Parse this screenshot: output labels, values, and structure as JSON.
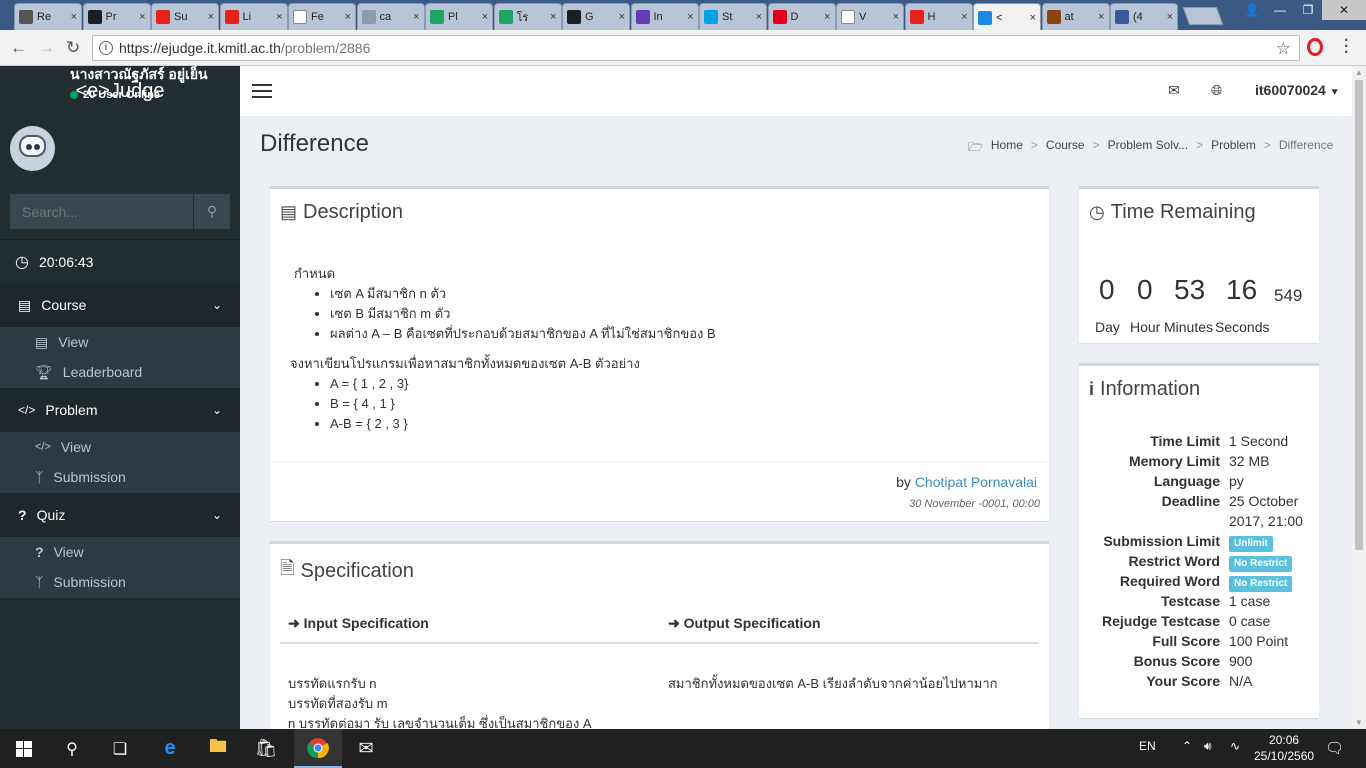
{
  "browser": {
    "tabs": [
      {
        "label": "Re",
        "icon": "app-icon",
        "color": "#555555"
      },
      {
        "label": "Pr",
        "icon": "github-icon",
        "color": "#1b1f23"
      },
      {
        "label": "Su",
        "icon": "youtube-icon",
        "color": "#e62117"
      },
      {
        "label": "Li",
        "icon": "youtube-icon",
        "color": "#e62117"
      },
      {
        "label": "Fe",
        "icon": "page-icon",
        "color": "#ffffff"
      },
      {
        "label": "ca",
        "icon": "code-icon",
        "color": "#8a9bb0"
      },
      {
        "label": "Pl",
        "icon": "drive-icon",
        "color": "#1fa463"
      },
      {
        "label": "โร",
        "icon": "drive-icon",
        "color": "#1fa463"
      },
      {
        "label": "G",
        "icon": "github-icon",
        "color": "#1b1f23"
      },
      {
        "label": "In",
        "icon": "forms-icon",
        "color": "#673ab7"
      },
      {
        "label": "St",
        "icon": "u-icon",
        "color": "#00a4e4"
      },
      {
        "label": "D",
        "icon": "music-icon",
        "color": "#e2001a"
      },
      {
        "label": "V",
        "icon": "page-icon",
        "color": "#ffffff"
      },
      {
        "label": "H",
        "icon": "youtube-icon",
        "color": "#e62117"
      },
      {
        "label": "<",
        "icon": "it-icon",
        "color": "#1e88e5",
        "active": true
      },
      {
        "label": "at",
        "icon": "paw-icon",
        "color": "#8b4513"
      },
      {
        "label": "(4",
        "icon": "facebook-icon",
        "color": "#3b5998"
      }
    ],
    "url_main": "https://ejudge.it.kmitl.ac.th",
    "url_path": "/problem/2886"
  },
  "app": {
    "brand": "<e>Judge",
    "user_fullname": "นางสาวณัฐภัสร์ อยู่เย็น",
    "online": "20 User Online",
    "search_placeholder": "Search...",
    "clock": "20:06:43",
    "menu": {
      "course": "Course",
      "course_view": "View",
      "course_leaderboard": "Leaderboard",
      "problem": "Problem",
      "problem_view": "View",
      "problem_submission": "Submission",
      "quiz": "Quiz",
      "quiz_view": "View",
      "quiz_submission": "Submission"
    },
    "topbar_user": "it60070024"
  },
  "page": {
    "title": "Difference",
    "breadcrumb": [
      "Home",
      "Course",
      "Problem Solv...",
      "Problem",
      "Difference"
    ]
  },
  "description": {
    "heading": "Description",
    "intro": "กำหนด",
    "bullets1": [
      "เซต A มีสมาชิก n ตัว",
      "เซต B มีสมาชิก m ตัว",
      "ผลต่าง A – B คือเซตที่ประกอบด้วยสมาชิกของ A ที่ไม่ใช่สมาชิกของ B"
    ],
    "task": "จงหาเขียนโปรแกรมเพื่อหาสมาชิกทั้งหมดของเซต A-B ตัวอย่าง",
    "bullets2": [
      "A = { 1 , 2 , 3}",
      "B = { 4 , 1 }",
      "A-B = { 2 , 3 }"
    ],
    "by": "by",
    "author": "Chotipat Pornavalai",
    "date": "30 November -0001, 00:00"
  },
  "specification": {
    "heading": "Specification",
    "input_heading": "Input Specification",
    "output_heading": "Output Specification",
    "input_lines": [
      "บรรทัดแรกรับ n",
      "บรรทัดที่สองรับ m",
      "n บรรทัดต่อมา รับ เลขจำนวนเต็ม ซึ่งเป็นสมาชิกของ A"
    ],
    "output_line": "สมาชิกทั้งหมดของเซต A-B เรียงลำดับจากค่าน้อยไปหามาก"
  },
  "time_remaining": {
    "heading": "Time Remaining",
    "day": "0",
    "hour": "0",
    "minute": "53",
    "second": "16",
    "ms": "549",
    "day_label": "Day",
    "hour_label": "Hour",
    "minute_label": "Minutes",
    "second_label": "Seconds"
  },
  "information": {
    "heading": "Information",
    "rows": [
      {
        "k": "Time Limit",
        "v": "1 Second"
      },
      {
        "k": "Memory Limit",
        "v": "32 MB"
      },
      {
        "k": "Language",
        "v": "py"
      },
      {
        "k": "Deadline",
        "v": "25 October"
      },
      {
        "k": "",
        "v": "2017, 21:00"
      },
      {
        "k": "Submission Limit",
        "badge": "Unlimit"
      },
      {
        "k": "Restrict Word",
        "badge": "No Restrict"
      },
      {
        "k": "Required Word",
        "badge": "No Restrict"
      },
      {
        "k": "Testcase",
        "v": "1 case"
      },
      {
        "k": "Rejudge Testcase",
        "v": "0 case"
      },
      {
        "k": "Full Score",
        "v": "100 Point"
      },
      {
        "k": "Bonus Score",
        "v": "900"
      },
      {
        "k": "Your Score",
        "v": "N/A"
      }
    ]
  },
  "taskbar": {
    "lang": "EN",
    "time": "20:06",
    "date": "25/10/2560"
  }
}
